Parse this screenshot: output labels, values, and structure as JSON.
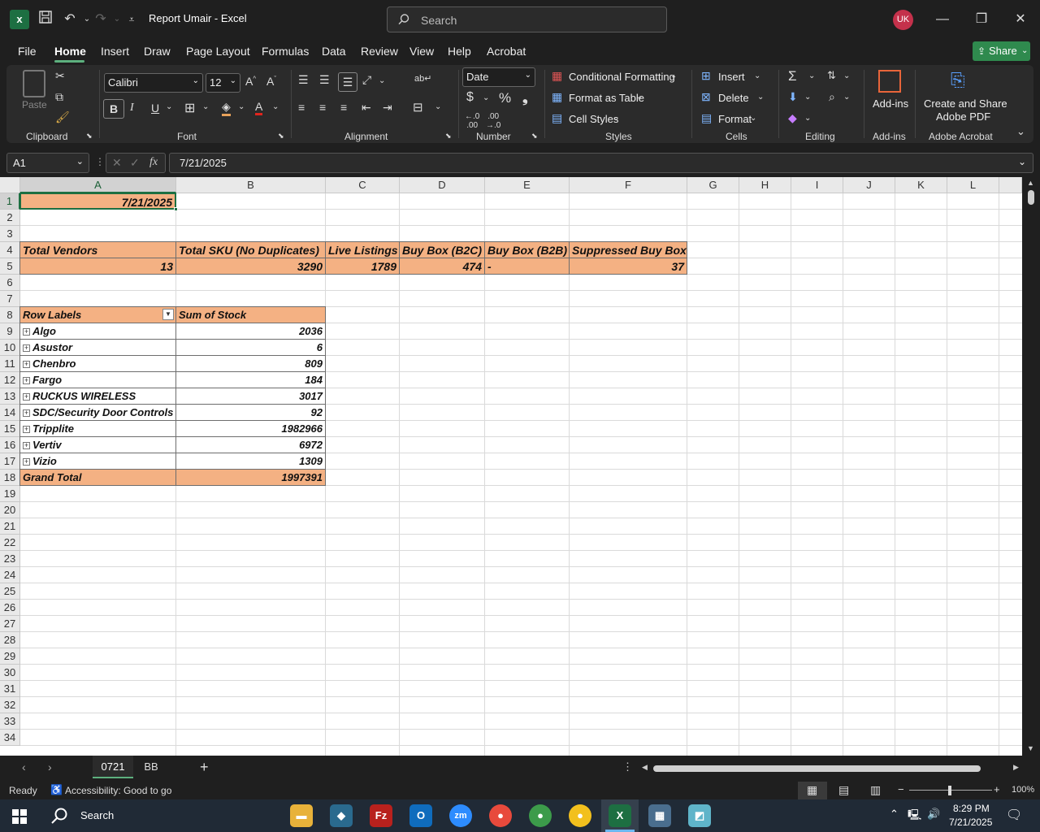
{
  "window": {
    "title": "Report Umair  -  Excel",
    "search_placeholder": "Search",
    "avatar": "UK"
  },
  "tabs": [
    "File",
    "Home",
    "Insert",
    "Draw",
    "Page Layout",
    "Formulas",
    "Data",
    "Review",
    "View",
    "Help",
    "Acrobat"
  ],
  "share_label": "Share",
  "ribbon": {
    "paste": "Paste",
    "clipboard": "Clipboard",
    "font_name": "Calibri",
    "font_size": "12",
    "font": "Font",
    "alignment": "Alignment",
    "number_format": "Date",
    "number": "Number",
    "conditional_formatting": "Conditional Formatting",
    "format_as_table": "Format as Table",
    "cell_styles": "Cell Styles",
    "styles": "Styles",
    "insert": "Insert",
    "delete": "Delete",
    "format": "Format",
    "cells": "Cells",
    "editing": "Editing",
    "addins": "Add-ins",
    "addins_group": "Add-ins",
    "create_share_1": "Create and Share",
    "create_share_2": "Adobe PDF",
    "adobe_acrobat": "Adobe Acrobat"
  },
  "formula_bar": {
    "name_box": "A1",
    "formula": "7/21/2025"
  },
  "columns": [
    "A",
    "B",
    "C",
    "D",
    "E",
    "F",
    "G",
    "H",
    "I",
    "J",
    "K",
    "L"
  ],
  "rows": [
    "1",
    "2",
    "3",
    "4",
    "5",
    "6",
    "7",
    "8",
    "9",
    "10",
    "11",
    "12",
    "13",
    "14",
    "15",
    "16",
    "17",
    "18",
    "19",
    "20",
    "21",
    "22",
    "23",
    "24",
    "25",
    "26",
    "27",
    "28",
    "29",
    "30",
    "31",
    "32",
    "33",
    "34"
  ],
  "sheet": {
    "date": "7/21/2025",
    "summary_headers": [
      "Total Vendors",
      "Total SKU (No Duplicates)",
      "Live Listings",
      "Buy Box (B2C)",
      "Buy Box (B2B)",
      "Suppressed Buy Box"
    ],
    "summary_values": [
      "13",
      "3290",
      "1789",
      "474",
      "-",
      "37"
    ],
    "pivot_headers": [
      "Row Labels",
      "Sum of Stock"
    ],
    "pivot_rows": [
      {
        "label": "Algo",
        "value": "2036"
      },
      {
        "label": "Asustor",
        "value": "6"
      },
      {
        "label": "Chenbro",
        "value": "809"
      },
      {
        "label": "Fargo",
        "value": "184"
      },
      {
        "label": "RUCKUS WIRELESS",
        "value": "3017"
      },
      {
        "label": "SDC/Security Door Controls",
        "value": "92"
      },
      {
        "label": "Tripplite",
        "value": "1982966"
      },
      {
        "label": "Vertiv",
        "value": "6972"
      },
      {
        "label": "Vizio",
        "value": "1309"
      }
    ],
    "grand_total_label": "Grand Total",
    "grand_total_value": "1997391"
  },
  "sheet_tabs": [
    "0721",
    "BB"
  ],
  "status": {
    "ready": "Ready",
    "accessibility": "Accessibility: Good to go",
    "zoom": "100%"
  },
  "taskbar": {
    "search": "Search",
    "time": "8:29 PM",
    "date": "7/21/2025"
  }
}
